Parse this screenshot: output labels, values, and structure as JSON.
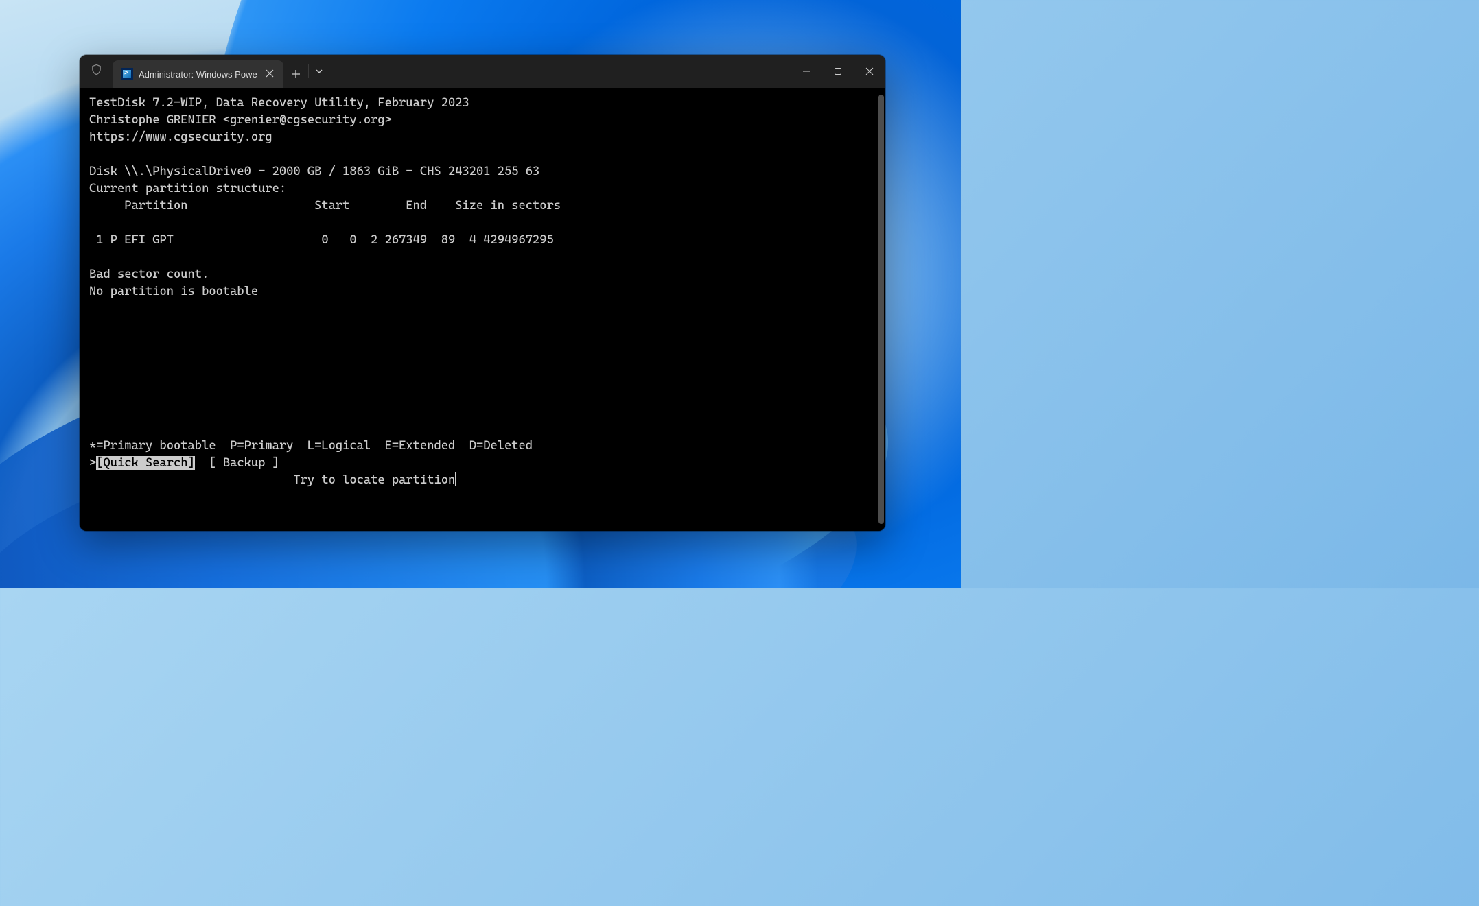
{
  "tab": {
    "title": "Administrator: Windows Powe"
  },
  "header": {
    "line1": "TestDisk 7.2-WIP, Data Recovery Utility, February 2023",
    "line2": "Christophe GRENIER <grenier@cgsecurity.org>",
    "line3": "https://www.cgsecurity.org"
  },
  "disk": {
    "info": "Disk \\\\.\\PhysicalDrive0 - 2000 GB / 1863 GiB - CHS 243201 255 63",
    "structure_label": "Current partition structure:",
    "columns": "     Partition                  Start        End    Size in sectors"
  },
  "partitions": {
    "row1": " 1 P EFI GPT                     0   0  2 267349  89  4 4294967295"
  },
  "status": {
    "bad_sector": "Bad sector count.",
    "no_bootable": "No partition is bootable"
  },
  "legend": "*=Primary bootable  P=Primary  L=Logical  E=Extended  D=Deleted",
  "menu": {
    "prefix": ">",
    "selected": "[Quick Search]",
    "gap": "  ",
    "backup": "[ Backup ]"
  },
  "hint": "                             Try to locate partition"
}
